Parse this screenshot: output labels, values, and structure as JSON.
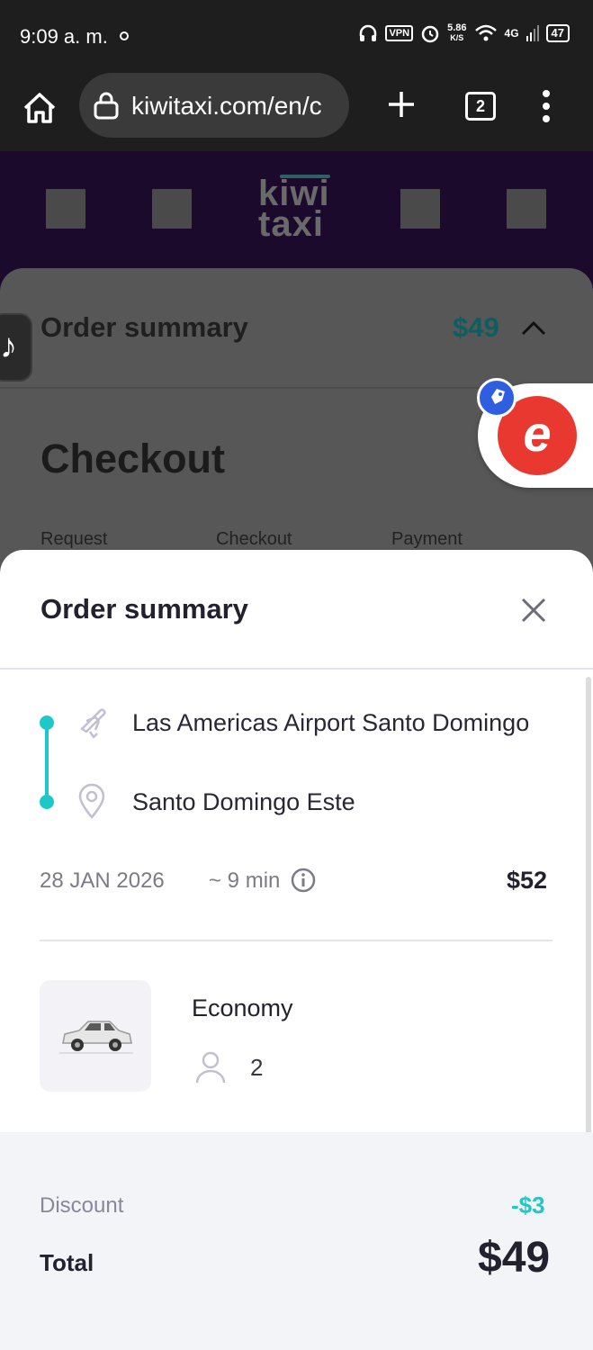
{
  "status_bar": {
    "time": "9:09 a. m.",
    "vpn": "VPN",
    "speed_value": "5.86",
    "speed_unit": "K/S",
    "network": "4G",
    "battery": "47"
  },
  "browser": {
    "url": "kiwitaxi.com/en/c",
    "tab_count": "2"
  },
  "site": {
    "logo_line1": "kiwi",
    "logo_line2": "taxi"
  },
  "underlying_page": {
    "summary_title": "Order summary",
    "summary_price": "$49",
    "checkout_title": "Checkout",
    "steps": [
      "Request",
      "Checkout",
      "Payment"
    ]
  },
  "overlay": {
    "coupon_letter": "e",
    "tiktok_glyph": "♪"
  },
  "sheet": {
    "title": "Order summary",
    "route": {
      "from": "Las Americas Airport Santo Domingo",
      "to": "Santo Domingo Este"
    },
    "date": "28 JAN 2026",
    "duration": "~ 9 min",
    "price": "$52",
    "vehicle": {
      "class": "Economy",
      "passengers": "2"
    },
    "discount_label": "Discount",
    "discount_value": "-$3",
    "total_label": "Total",
    "total_value": "$49"
  },
  "colors": {
    "accent": "#1fc8c8",
    "header_bg": "#1c0a2c",
    "text_dark": "#24212f",
    "coupon_red": "#e8382f"
  }
}
